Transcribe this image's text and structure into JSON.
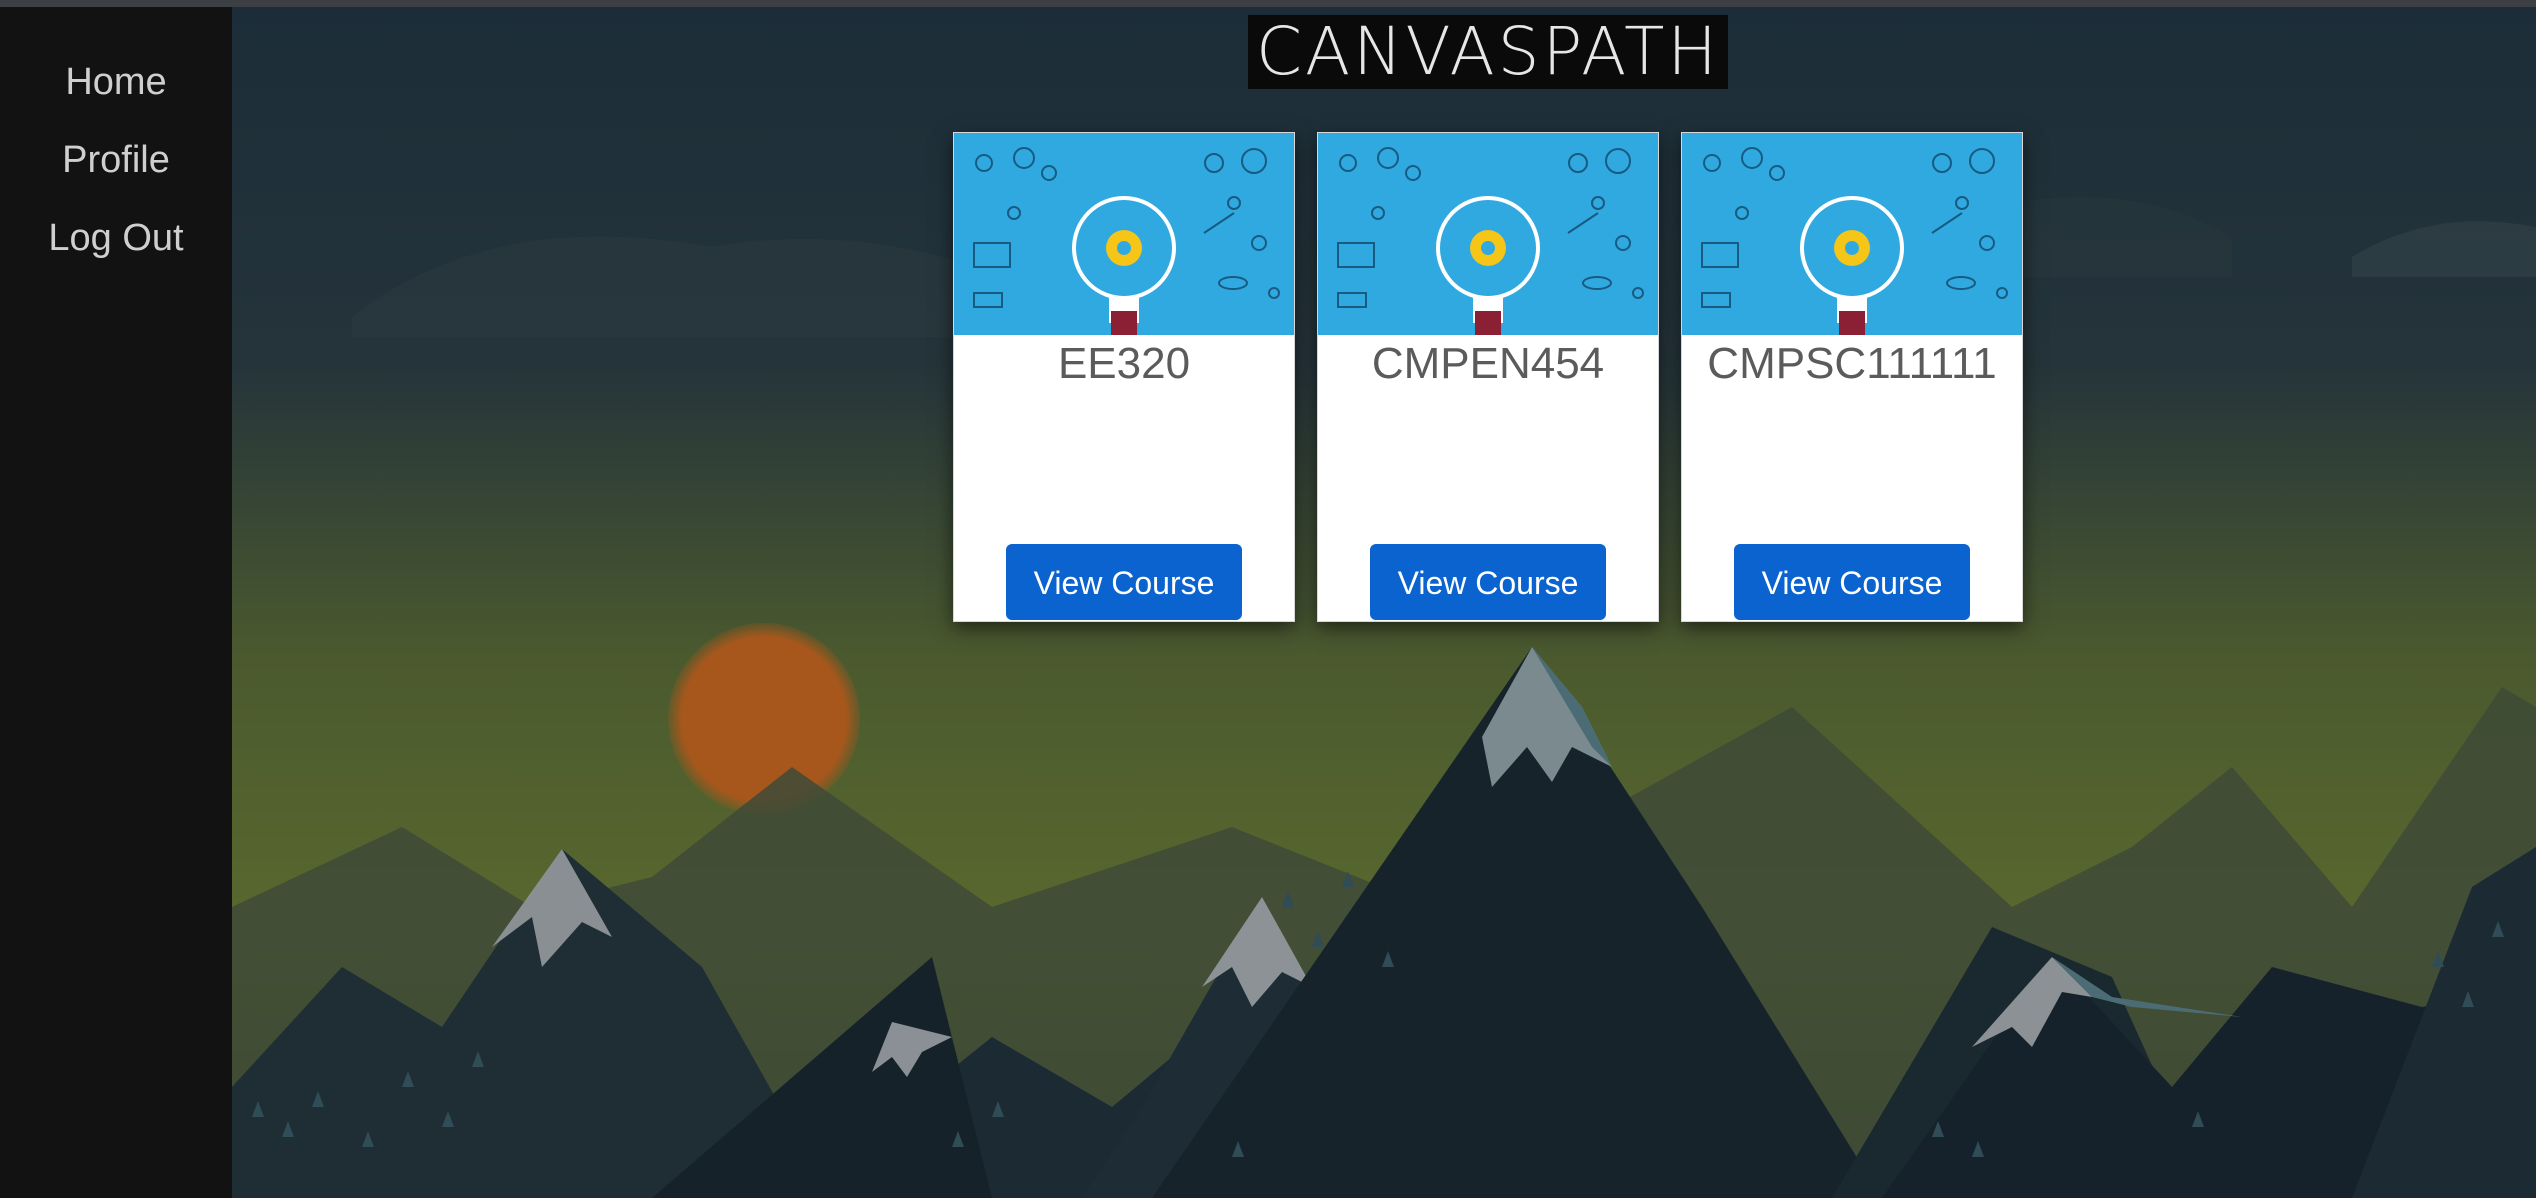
{
  "nav": {
    "items": [
      {
        "label": "Home"
      },
      {
        "label": "Profile"
      },
      {
        "label": "Log Out"
      }
    ]
  },
  "header": {
    "logo_text": "CANVASPATH"
  },
  "courses": [
    {
      "code": "EE320",
      "button_label": "View Course"
    },
    {
      "code": "CMPEN454",
      "button_label": "View Course"
    },
    {
      "code": "CMPSC111111",
      "button_label": "View Course"
    }
  ],
  "colors": {
    "sidebar_bg": "#121212",
    "button_bg": "#0a63cf",
    "card_thumb_bg": "#2fa9e0",
    "sun": "#a8571c"
  }
}
